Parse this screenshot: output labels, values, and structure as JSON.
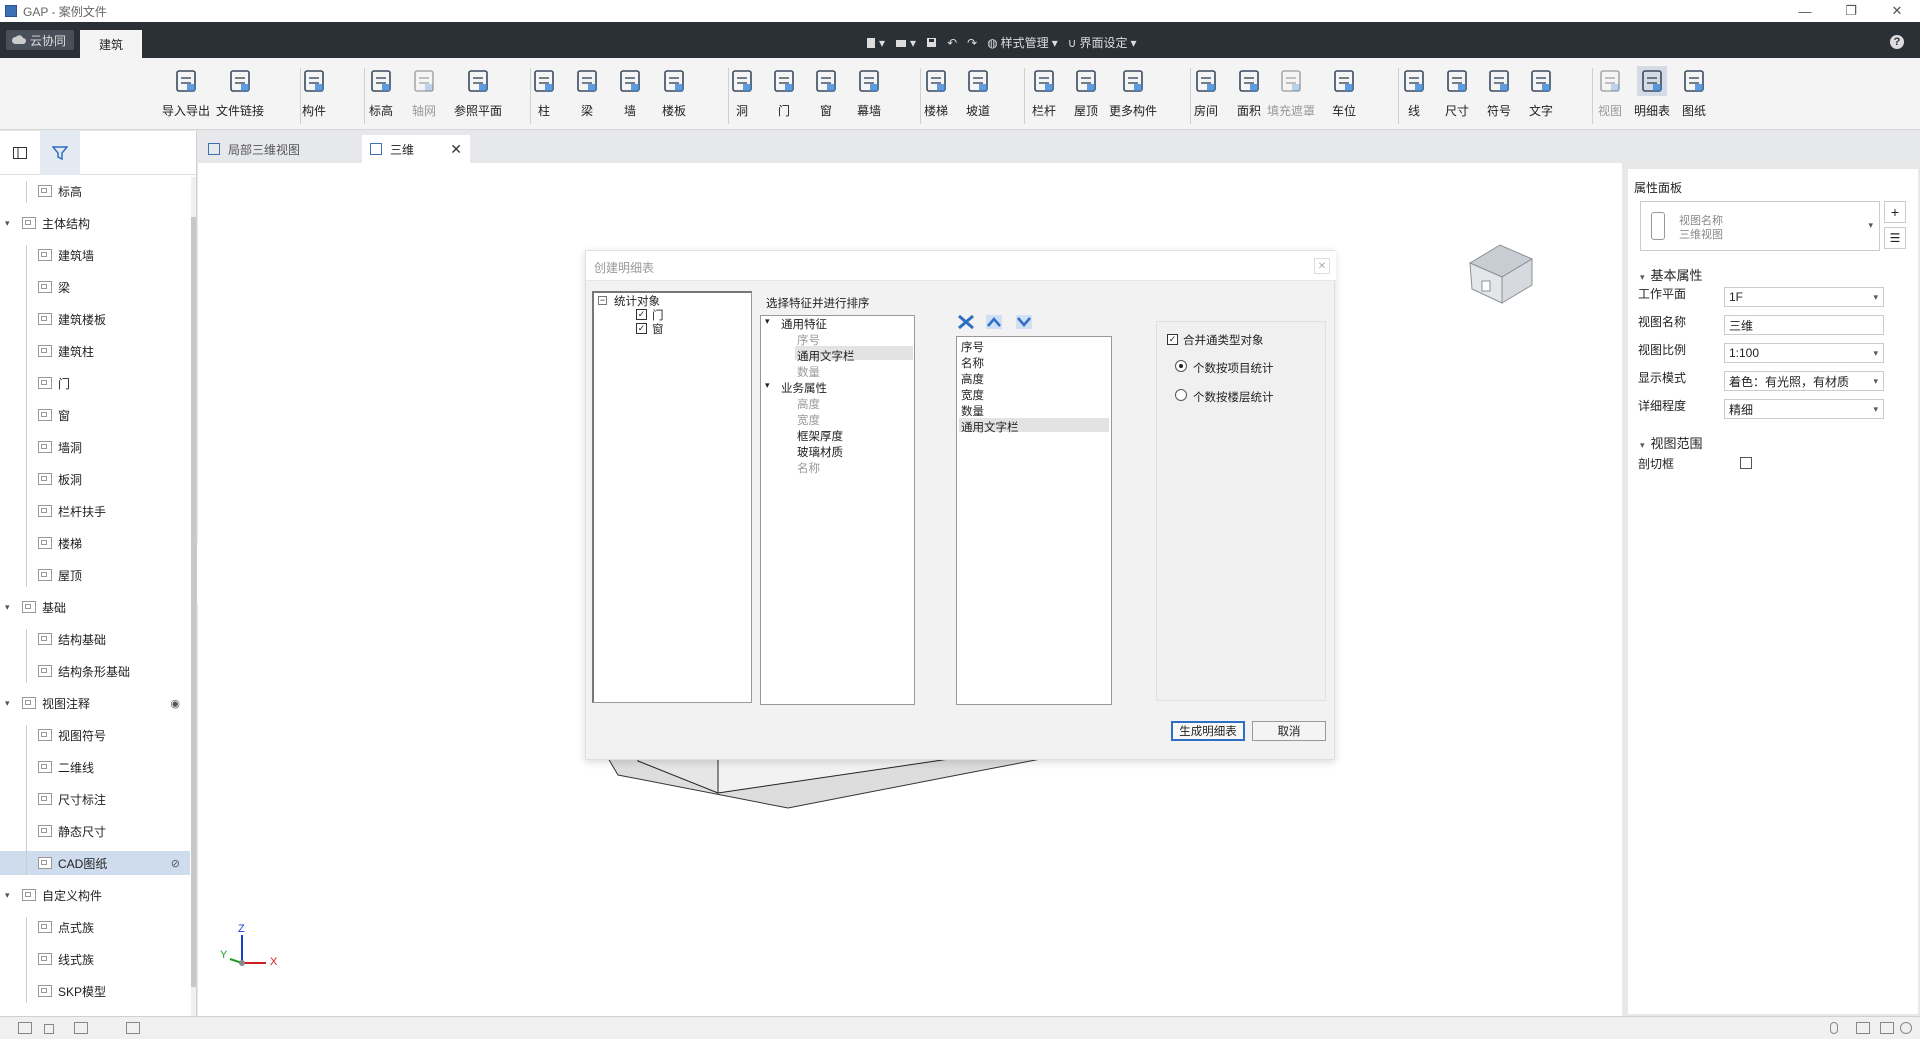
{
  "window": {
    "title": "GAP - 案例文件",
    "minimize": "—",
    "restore": "❐",
    "close": "✕"
  },
  "topbar": {
    "cloud_tab": "云协同",
    "arch_tab": "建筑",
    "style_mgmt": "样式管理",
    "ui_settings": "界面设定",
    "help": "?"
  },
  "ribbon": {
    "items": [
      {
        "label": "导入导出",
        "icon": "cad-import-icon"
      },
      {
        "label": "文件链接",
        "icon": "file-link-icon"
      },
      {
        "label": "构件",
        "icon": "component-icon"
      },
      {
        "label": "标高",
        "icon": "level-icon"
      },
      {
        "label": "轴网",
        "icon": "grid-icon"
      },
      {
        "label": "参照平面",
        "icon": "reference-plane-icon"
      },
      {
        "label": "柱",
        "icon": "column-icon"
      },
      {
        "label": "梁",
        "icon": "beam-icon"
      },
      {
        "label": "墙",
        "icon": "wall-icon"
      },
      {
        "label": "楼板",
        "icon": "slab-icon"
      },
      {
        "label": "洞",
        "icon": "opening-icon"
      },
      {
        "label": "门",
        "icon": "door-icon"
      },
      {
        "label": "窗",
        "icon": "window-icon"
      },
      {
        "label": "幕墙",
        "icon": "curtain-wall-icon"
      },
      {
        "label": "楼梯",
        "icon": "stair-icon"
      },
      {
        "label": "坡道",
        "icon": "ramp-icon"
      },
      {
        "label": "栏杆",
        "icon": "railing-icon"
      },
      {
        "label": "屋顶",
        "icon": "roof-icon"
      },
      {
        "label": "更多构件",
        "icon": "more-components-icon"
      },
      {
        "label": "房间",
        "icon": "room-icon"
      },
      {
        "label": "面积",
        "icon": "area-icon"
      },
      {
        "label": "填充遮罩",
        "icon": "fill-mask-icon"
      },
      {
        "label": "车位",
        "icon": "parking-icon"
      },
      {
        "label": "线",
        "icon": "line-icon"
      },
      {
        "label": "尺寸",
        "icon": "dimension-icon"
      },
      {
        "label": "符号",
        "icon": "symbol-icon"
      },
      {
        "label": "文字",
        "icon": "text-icon"
      },
      {
        "label": "视图",
        "icon": "view-icon"
      },
      {
        "label": "明细表",
        "icon": "schedule-icon"
      },
      {
        "label": "图纸",
        "icon": "sheet-icon"
      }
    ]
  },
  "tree": {
    "items": [
      {
        "label": "标高",
        "level": 1
      },
      {
        "label": "主体结构",
        "level": 0
      },
      {
        "label": "建筑墙",
        "level": 1
      },
      {
        "label": "梁",
        "level": 1
      },
      {
        "label": "建筑楼板",
        "level": 1
      },
      {
        "label": "建筑柱",
        "level": 1
      },
      {
        "label": "门",
        "level": 1
      },
      {
        "label": "窗",
        "level": 1
      },
      {
        "label": "墙洞",
        "level": 1
      },
      {
        "label": "板洞",
        "level": 1
      },
      {
        "label": "栏杆扶手",
        "level": 1
      },
      {
        "label": "楼梯",
        "level": 1
      },
      {
        "label": "屋顶",
        "level": 1
      },
      {
        "label": "基础",
        "level": 0
      },
      {
        "label": "结构基础",
        "level": 1
      },
      {
        "label": "结构条形基础",
        "level": 1
      },
      {
        "label": "视图注释",
        "level": 0
      },
      {
        "label": "视图符号",
        "level": 1
      },
      {
        "label": "二维线",
        "level": 1
      },
      {
        "label": "尺寸标注",
        "level": 1
      },
      {
        "label": "静态尺寸",
        "level": 1
      },
      {
        "label": "CAD图纸",
        "level": 1
      },
      {
        "label": "自定义构件",
        "level": 0
      },
      {
        "label": "点式族",
        "level": 1
      },
      {
        "label": "线式族",
        "level": 1
      },
      {
        "label": "SKP模型",
        "level": 1
      }
    ]
  },
  "doc_tabs": {
    "tab1": "局部三维视图",
    "tab2": "三维"
  },
  "axes": {
    "x": "X",
    "y": "Y",
    "z": "Z"
  },
  "dialog": {
    "title": "创建明细表",
    "stat_root": "统计对象",
    "stat_door": "门",
    "stat_window": "窗",
    "select_header": "选择特征并进行排序",
    "general_group": "通用特征",
    "general_items": [
      "序号",
      "通用文字栏",
      "数量"
    ],
    "business_group": "业务属性",
    "business_items": [
      "高度",
      "宽度",
      "框架厚度",
      "玻璃材质",
      "名称"
    ],
    "selected_items": [
      "序号",
      "名称",
      "高度",
      "宽度",
      "数量",
      "通用文字栏"
    ],
    "merge_label": "合并通类型对象",
    "radio1": "个数按项目统计",
    "radio2": "个数按楼层统计",
    "generate": "生成明细表",
    "cancel": "取消"
  },
  "properties": {
    "title": "属性面板",
    "view_name_hint": "视图名称",
    "view_type": "三维视图",
    "basic_section": "基本属性",
    "work_plane_label": "工作平面",
    "work_plane_value": "1F",
    "view_name_label": "视图名称",
    "view_name_value": "三维",
    "scale_label": "视图比例",
    "scale_value": "1:100",
    "display_label": "显示模式",
    "display_value": "着色：有光照，有材质",
    "detail_label": "详细程度",
    "detail_value": "精细",
    "range_section": "视图范围",
    "section_box_label": "剖切框"
  },
  "colors": {
    "accent": "#2d6fc4",
    "darkbar": "#2b2f36",
    "selection": "#cfdcee"
  }
}
